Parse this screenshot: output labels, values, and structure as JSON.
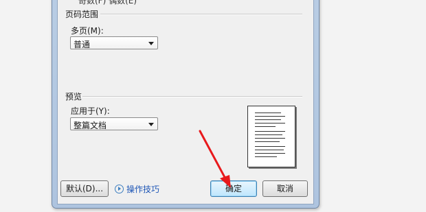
{
  "top_partial": {
    "text": "奇数(F)    偶数(E)"
  },
  "page_range": {
    "title": "页码范围",
    "multiple_pages_label": "多页(M):",
    "multiple_pages_value": "普通"
  },
  "preview": {
    "title": "预览",
    "apply_to_label": "应用于(Y):",
    "apply_to_value": "整篇文档"
  },
  "footer": {
    "default_button": "默认(D)...",
    "tips_link": "操作技巧",
    "ok_button": "确定",
    "cancel_button": "取消"
  },
  "colors": {
    "annotation_arrow": "#e8191c",
    "link": "#1e56b6",
    "default_button_border": "#3c7fb1"
  }
}
